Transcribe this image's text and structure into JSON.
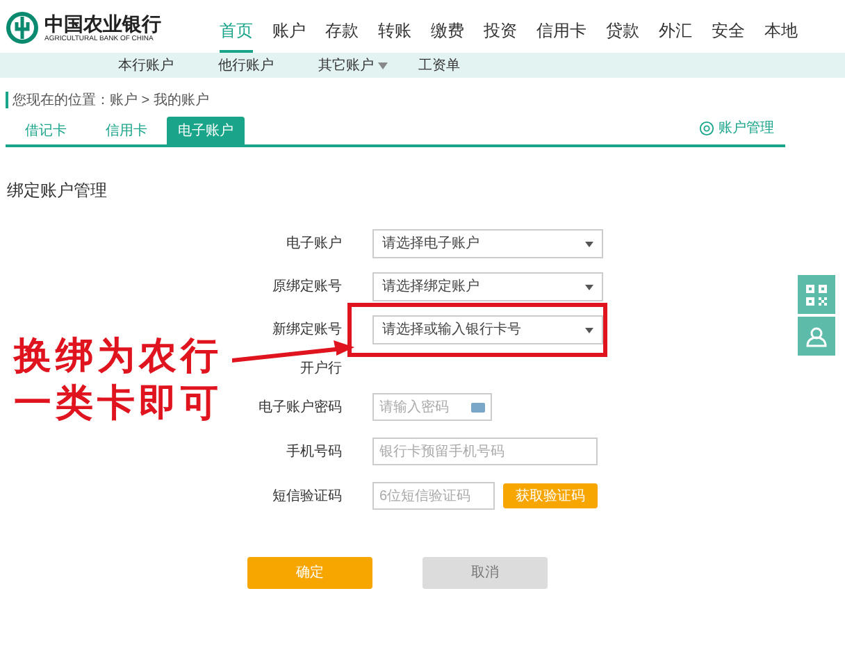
{
  "logo": {
    "name": "中国农业银行",
    "subtitle": "AGRICULTURAL BANK OF CHINA"
  },
  "nav": [
    {
      "label": "首页",
      "selected": true
    },
    {
      "label": "账户",
      "selected": false
    },
    {
      "label": "存款",
      "selected": false
    },
    {
      "label": "转账",
      "selected": false
    },
    {
      "label": "缴费",
      "selected": false
    },
    {
      "label": "投资",
      "selected": false
    },
    {
      "label": "信用卡",
      "selected": false
    },
    {
      "label": "贷款",
      "selected": false
    },
    {
      "label": "外汇",
      "selected": false
    },
    {
      "label": "安全",
      "selected": false
    },
    {
      "label": "本地",
      "selected": false
    }
  ],
  "subnav": [
    {
      "label": "本行账户",
      "dropdown": false
    },
    {
      "label": "他行账户",
      "dropdown": false
    },
    {
      "label": "其它账户",
      "dropdown": true
    },
    {
      "label": "工资单",
      "dropdown": false
    }
  ],
  "breadcrumb": "您现在的位置：账户 > 我的账户",
  "tabs": [
    {
      "label": "借记卡",
      "selected": false
    },
    {
      "label": "信用卡",
      "selected": false
    },
    {
      "label": "电子账户",
      "selected": true
    }
  ],
  "account_management": "账户管理",
  "section_title": "绑定账户管理",
  "form": [
    {
      "kind": "select",
      "label": "电子账户",
      "placeholder": "请选择电子账户",
      "highlighted": false
    },
    {
      "kind": "select",
      "label": "原绑定账号",
      "placeholder": "请选择绑定账户",
      "highlighted": false
    },
    {
      "kind": "select",
      "label": "新绑定账号",
      "placeholder": "请选择或输入银行卡号",
      "highlighted": true
    },
    {
      "kind": "static",
      "label": "开户行"
    },
    {
      "kind": "password",
      "label": "电子账户密码",
      "placeholder": "请输入密码"
    },
    {
      "kind": "text",
      "label": "手机号码",
      "placeholder": "银行卡预留手机号码"
    },
    {
      "kind": "sms",
      "label": "短信验证码",
      "placeholder": "6位短信验证码",
      "button": "获取验证码"
    }
  ],
  "buttons": [
    {
      "label": "确定",
      "disabled": false
    },
    {
      "label": "取消",
      "disabled": true
    }
  ],
  "annotation": {
    "lines": [
      "换绑为农行",
      "一类卡即可"
    ]
  }
}
